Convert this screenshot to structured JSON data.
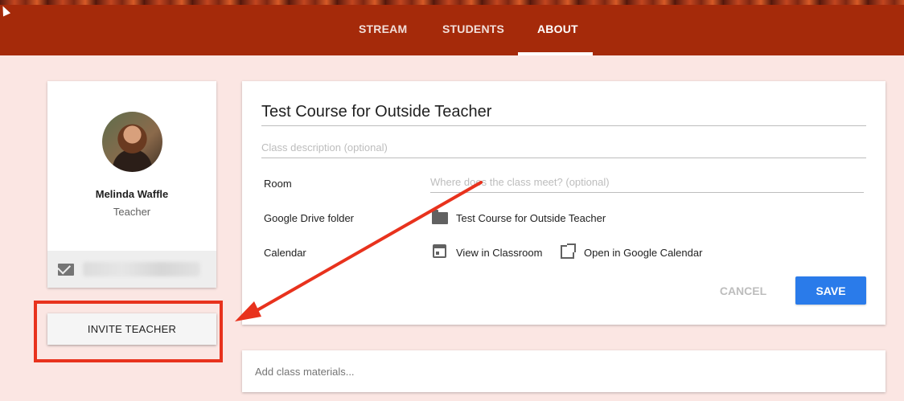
{
  "header": {
    "tabs": [
      {
        "label": "STREAM"
      },
      {
        "label": "STUDENTS"
      },
      {
        "label": "ABOUT"
      }
    ],
    "active_tab": "ABOUT"
  },
  "teacher": {
    "name": "Melinda Waffle",
    "role": "Teacher"
  },
  "invite_button": {
    "label": "INVITE TEACHER"
  },
  "course": {
    "title": "Test Course for Outside Teacher",
    "description_placeholder": "Class description (optional)",
    "room_label": "Room",
    "room_placeholder": "Where does the class meet? (optional)",
    "drive_label": "Google Drive folder",
    "drive_folder": "Test Course for Outside Teacher",
    "calendar_label": "Calendar",
    "view_in_classroom": "View in Classroom",
    "open_in_google_calendar": "Open in Google Calendar",
    "cancel_label": "CANCEL",
    "save_label": "SAVE"
  },
  "materials": {
    "placeholder": "Add class materials..."
  },
  "colors": {
    "header": "#a52a0a",
    "background": "#fbe6e3",
    "save_button": "#2a7bea",
    "annotation": "#e8321d"
  }
}
